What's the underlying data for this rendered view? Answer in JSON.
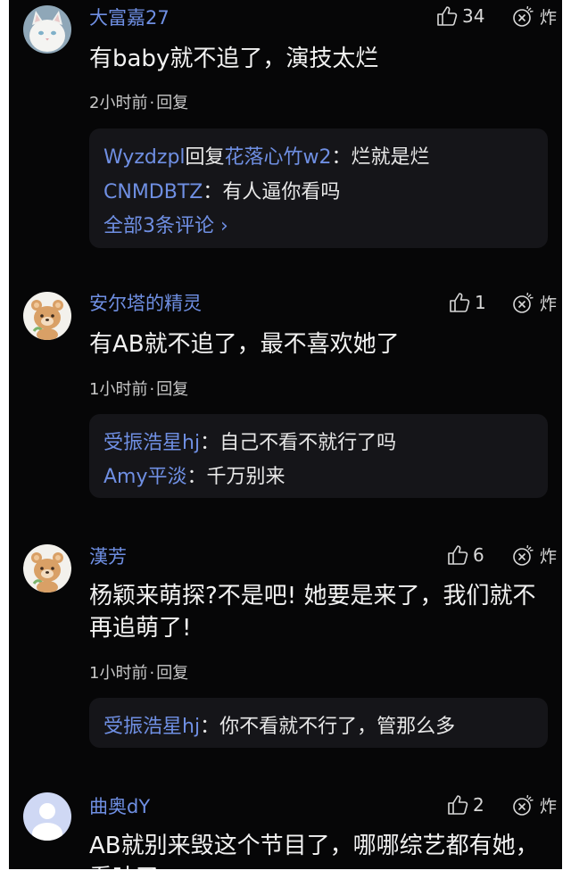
{
  "comments": [
    {
      "username": "大富嘉27",
      "avatar": "white-cat-icon",
      "likes": "34",
      "bomb_label": "炸",
      "text": "有baby就不追了，演技太烂",
      "time": "2小时前",
      "separator": "·",
      "reply_label": "回复",
      "replies": [
        {
          "name": "Wyzdzpl",
          "mid": "回复",
          "target": "花落心竹w2",
          "text": "：烂就是烂"
        },
        {
          "name": "CNMDBTZ",
          "text": "：有人逼你看吗"
        }
      ],
      "more": "全部3条评论 ›"
    },
    {
      "username": "安尔塔的精灵",
      "avatar": "bear-icon",
      "likes": "1",
      "bomb_label": "炸",
      "text": "有AB就不追了，最不喜欢她了",
      "time": "1小时前",
      "separator": "·",
      "reply_label": "回复",
      "replies": [
        {
          "name": "受振浩星hj",
          "text": "：自己不看不就行了吗"
        },
        {
          "name": "Amy平淡",
          "text": "：千万别来"
        }
      ]
    },
    {
      "username": "漢芳",
      "avatar": "bear-icon",
      "likes": "6",
      "bomb_label": "炸",
      "text": "杨颖来萌探?不是吧! 她要是来了，我们就不再追萌了!",
      "time": "1小时前",
      "separator": "·",
      "reply_label": "回复",
      "replies": [
        {
          "name": "受振浩星hj",
          "text": "：你不看就不行了，管那么多"
        }
      ]
    },
    {
      "username": "曲奥dY",
      "avatar": "default-user-icon",
      "likes": "2",
      "bomb_label": "炸",
      "text": "AB就别来毁这个节目了，哪哪综艺都有她，看吐了"
    }
  ]
}
